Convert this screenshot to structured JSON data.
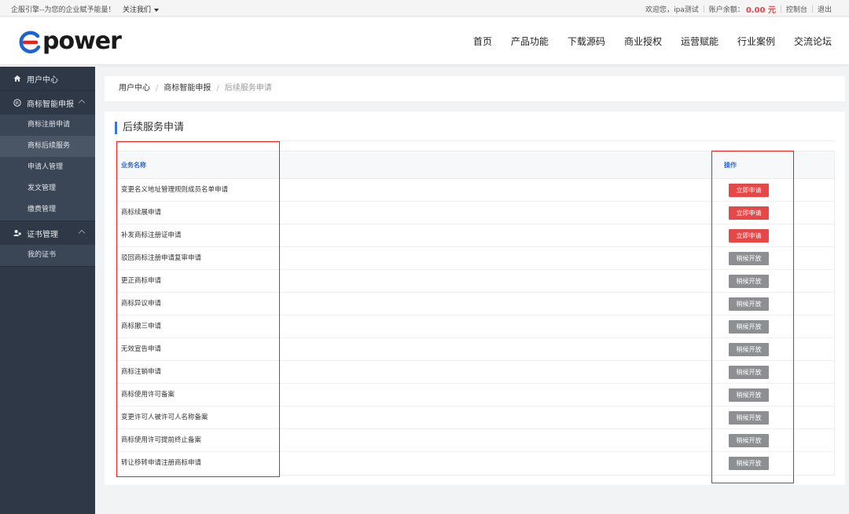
{
  "topbar": {
    "slogan": "企服引擎--为您的企业赋予能量！",
    "follow_label": "关注我们",
    "welcome": "欢迎您，",
    "username": "ipa测试",
    "balance_label": "账户余额：",
    "balance_value": "0.00 元",
    "console": "控制台",
    "logout": "退出"
  },
  "header": {
    "logo_text": "power",
    "nav": [
      "首页",
      "产品功能",
      "下载源码",
      "商业授权",
      "运营赋能",
      "行业案例",
      "交流论坛"
    ]
  },
  "sidebar": {
    "groups": [
      {
        "label": "用户中心",
        "icon": "home-icon",
        "items": []
      },
      {
        "label": "商标智能申报",
        "icon": "registered-mark-icon",
        "items": [
          "商标注册申请",
          "商标后续服务",
          "申请人管理",
          "发文管理",
          "缴费管理"
        ]
      },
      {
        "label": "证书管理",
        "icon": "user-certificate-icon",
        "items": [
          "我的证书"
        ]
      }
    ],
    "active_item": "商标后续服务"
  },
  "breadcrumb": {
    "items": [
      "用户中心",
      "商标智能申报",
      "后续服务申请"
    ]
  },
  "panel": {
    "title": "后续服务申请",
    "columns": {
      "name": "业务名称",
      "action": "操作"
    },
    "buttons": {
      "apply": "立即申请",
      "soon": "稍候开放"
    },
    "rows": [
      {
        "name": "变更名义地址管理规则成员名单申请",
        "status": "apply"
      },
      {
        "name": "商标续展申请",
        "status": "apply"
      },
      {
        "name": "补发商标注册证申请",
        "status": "apply"
      },
      {
        "name": "驳回商标注册申请复审申请",
        "status": "soon"
      },
      {
        "name": "更正商标申请",
        "status": "soon"
      },
      {
        "name": "商标异议申请",
        "status": "soon"
      },
      {
        "name": "商标撤三申请",
        "status": "soon"
      },
      {
        "name": "无效宣告申请",
        "status": "soon"
      },
      {
        "name": "商标注销申请",
        "status": "soon"
      },
      {
        "name": "商标使用许可备案",
        "status": "soon"
      },
      {
        "name": "变更许可人被许可人名称备案",
        "status": "soon"
      },
      {
        "name": "商标使用许可提前终止备案",
        "status": "soon"
      },
      {
        "name": "转让移转申请注册商标申请",
        "status": "soon"
      }
    ]
  },
  "colors": {
    "accent": "#3a78d6",
    "apply_button": "#e64848",
    "soon_button": "#8d8f93",
    "sidebar_bg": "#2e3847",
    "highlight": "#e8221a",
    "logo_blue": "#1e63d6",
    "logo_red": "#e8221a"
  }
}
